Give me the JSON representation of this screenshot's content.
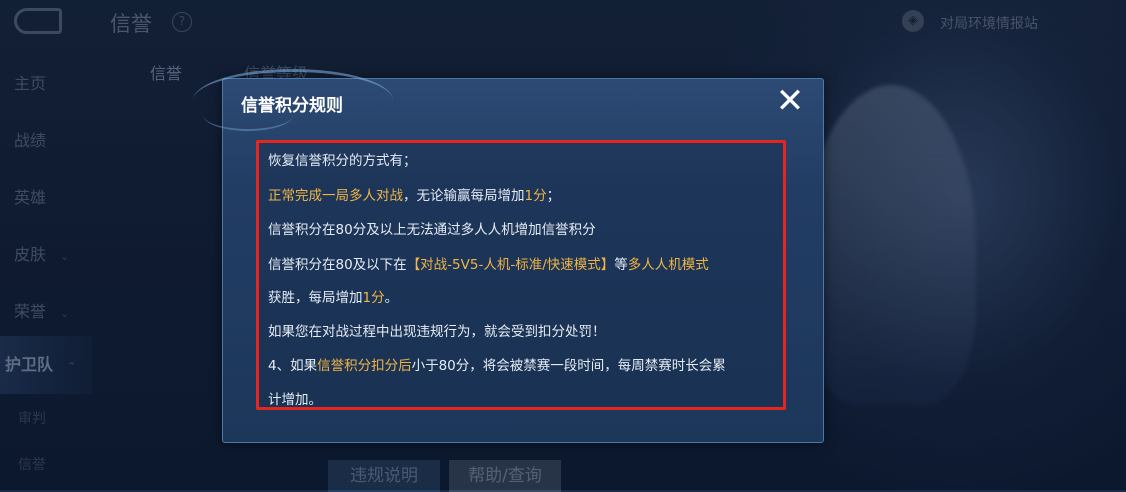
{
  "header": {
    "title": "信誉",
    "help_glyph": "?",
    "report_link": "对局环境情报站"
  },
  "sidebar": {
    "items": [
      {
        "label": "主页"
      },
      {
        "label": "战绩"
      },
      {
        "label": "英雄"
      },
      {
        "label": "皮肤",
        "chevron": "⌄"
      },
      {
        "label": "荣誉",
        "chevron": "⌄"
      },
      {
        "label": "护卫队",
        "chevron": "⌃"
      }
    ],
    "subitems": [
      "审判",
      "信誉"
    ]
  },
  "tabs": [
    {
      "label": "信誉",
      "active": true
    },
    {
      "label": "信誉等级",
      "active": false
    }
  ],
  "bottom_buttons": [
    {
      "label": "违规说明"
    },
    {
      "label": "帮助/查询"
    }
  ],
  "dialog": {
    "title": "信誉积分规则",
    "close_glyph": "✕",
    "lines": [
      [
        {
          "t": "恢复信誉积分的方式有；",
          "h": false
        }
      ],
      [
        {
          "t": "正常完成一局多人对战",
          "h": true
        },
        {
          "t": "，无论输赢每局增加",
          "h": false
        },
        {
          "t": "1分",
          "h": true
        },
        {
          "t": "；",
          "h": false
        }
      ],
      [
        {
          "t": "信誉积分在80分及以上无法通过多人人机增加信誉积分",
          "h": false
        }
      ],
      [
        {
          "t": "信誉积分在80及以下在",
          "h": false
        },
        {
          "t": "【对战-5V5-人机-标准/快速模式】",
          "h": true
        },
        {
          "t": "等",
          "h": false
        },
        {
          "t": "多人人机模式",
          "h": true
        }
      ],
      [
        {
          "t": "获胜，每局增加",
          "h": false
        },
        {
          "t": "1分",
          "h": true
        },
        {
          "t": "。",
          "h": false
        }
      ],
      [
        {
          "t": "如果您在对战过程中出现违规行为，就会受到扣分处罚！",
          "h": false
        }
      ],
      [
        {
          "t": "4、如果",
          "h": false
        },
        {
          "t": "信誉积分扣分后",
          "h": true
        },
        {
          "t": "小于80分，将会被禁赛一段时间，每周禁赛时长会累",
          "h": false
        }
      ],
      [
        {
          "t": "计增加。",
          "h": false
        }
      ]
    ]
  },
  "colors": {
    "highlight": "#f0b545",
    "annotation_border": "#e52520",
    "dialog_bg": "#223d64",
    "text": "#e6ecf5"
  }
}
